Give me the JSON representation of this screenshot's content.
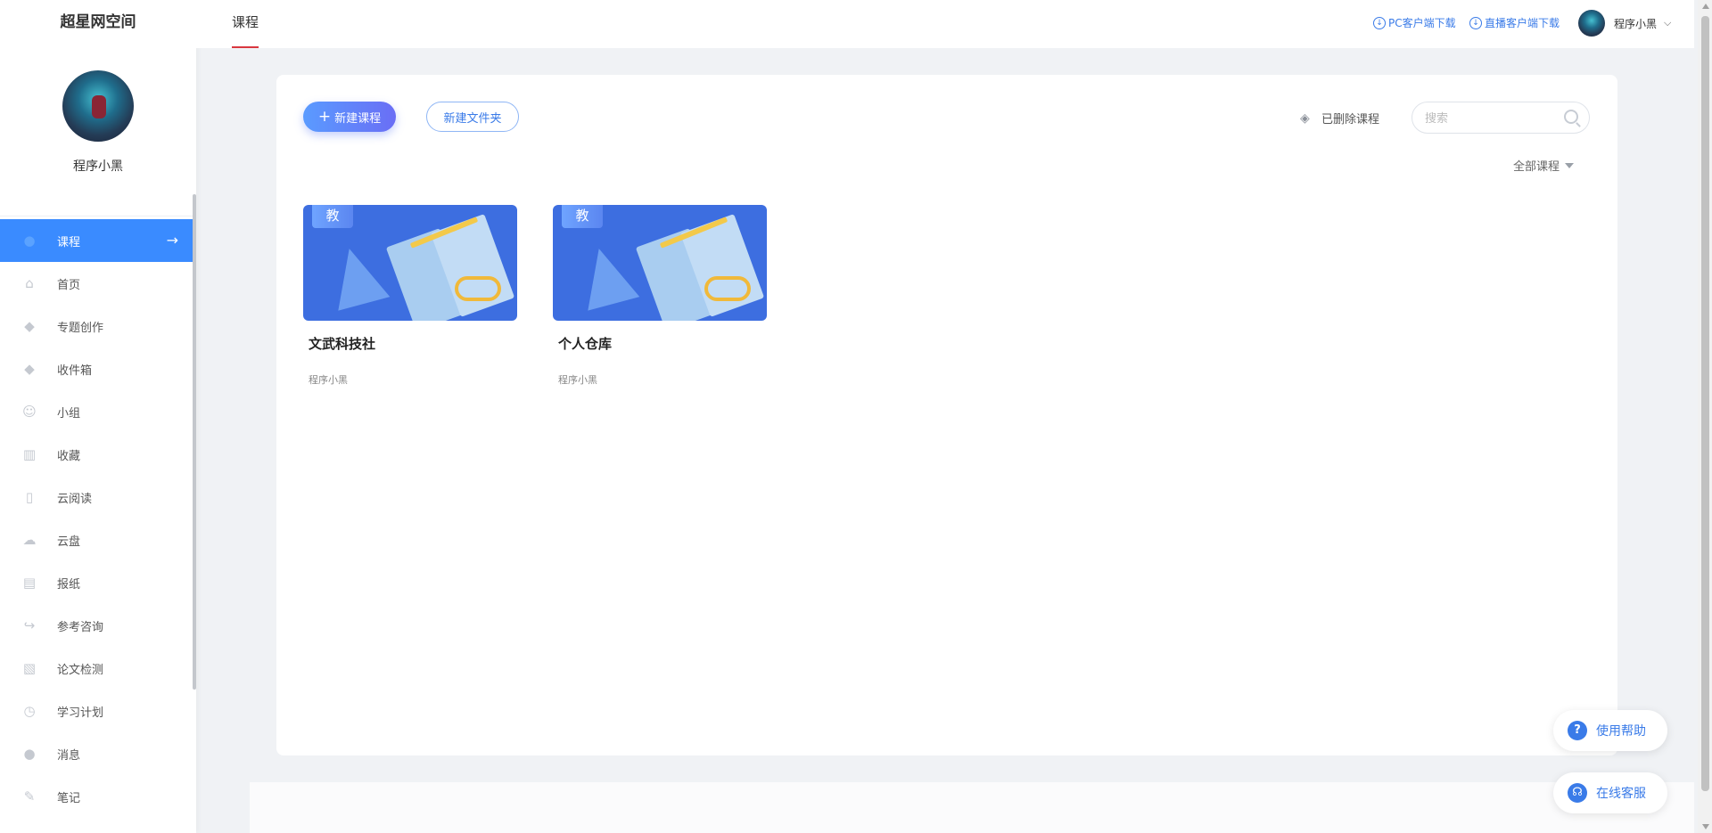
{
  "brand": "超星网空间",
  "profile": {
    "name": "程序小黑"
  },
  "sidebar": {
    "items": [
      {
        "label": "课程",
        "icon": "course-icon",
        "active": true
      },
      {
        "label": "首页",
        "icon": "home-icon"
      },
      {
        "label": "专题创作",
        "icon": "topic-icon"
      },
      {
        "label": "收件箱",
        "icon": "inbox-icon"
      },
      {
        "label": "小组",
        "icon": "group-icon"
      },
      {
        "label": "收藏",
        "icon": "bookmark-icon"
      },
      {
        "label": "云阅读",
        "icon": "reading-icon"
      },
      {
        "label": "云盘",
        "icon": "cloud-icon"
      },
      {
        "label": "报纸",
        "icon": "newspaper-icon"
      },
      {
        "label": "参考咨询",
        "icon": "consult-icon"
      },
      {
        "label": "论文检测",
        "icon": "paper-check-icon"
      },
      {
        "label": "学习计划",
        "icon": "alarm-icon"
      },
      {
        "label": "消息",
        "icon": "message-icon"
      },
      {
        "label": "笔记",
        "icon": "note-icon"
      }
    ]
  },
  "topbar": {
    "tab": "课程",
    "pc_download": "PC客户端下载",
    "live_download": "直播客户端下载",
    "user_name": "程序小黑"
  },
  "toolbar": {
    "new_course": "新建课程",
    "new_folder": "新建文件夹",
    "deleted_courses": "已删除课程",
    "search_placeholder": "搜索",
    "filter": "全部课程"
  },
  "courses": [
    {
      "tag": "教",
      "title": "文武科技社",
      "teacher": "程序小黑"
    },
    {
      "tag": "教",
      "title": "个人仓库",
      "teacher": "程序小黑"
    }
  ],
  "float": {
    "help": "使用帮助",
    "service": "在线客服"
  },
  "colors": {
    "accent": "#3a8bff",
    "tab_underline": "#d9373f"
  }
}
